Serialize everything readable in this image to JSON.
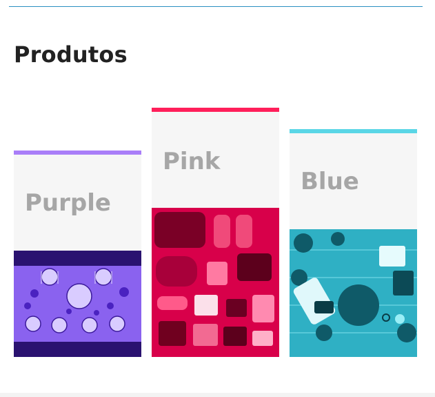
{
  "section": {
    "title": "Produtos"
  },
  "cards": [
    {
      "label": "Purple",
      "accent_color": "#a97ef8",
      "photo_tint": "#6a35e6",
      "photo_subject": "dining-table-photo"
    },
    {
      "label": "Pink",
      "accent_color": "#ff1f5a",
      "photo_tint": "#e0004a",
      "photo_subject": "camping-gear-photo"
    },
    {
      "label": "Blue",
      "accent_color": "#5ad6e6",
      "photo_tint": "#22b4c8",
      "photo_subject": "crafts-desk-photo"
    }
  ]
}
